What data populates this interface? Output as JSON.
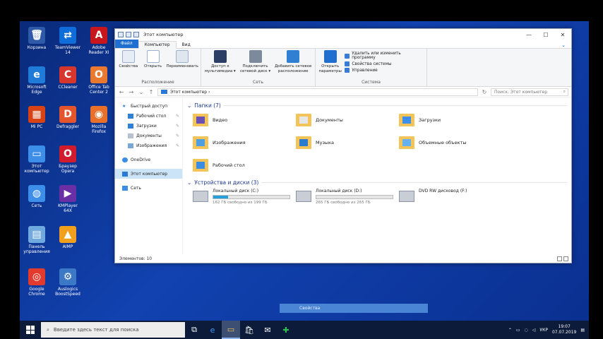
{
  "desktop": {
    "icons": [
      {
        "label": "Корзина",
        "glyph": "🗑",
        "bg": "#2e5aa8"
      },
      {
        "label": "TeamViewer 14",
        "glyph": "⇄",
        "bg": "#0e6dd8"
      },
      {
        "label": "Adobe Reader XI",
        "glyph": "A",
        "bg": "#c8161d"
      },
      {
        "label": "Microsoft Edge",
        "glyph": "e",
        "bg": "#1f7ad8"
      },
      {
        "label": "CCleaner",
        "glyph": "C",
        "bg": "#d6362b"
      },
      {
        "label": "Office Tab Center 2",
        "glyph": "O",
        "bg": "#e9792f"
      },
      {
        "label": "Mi PC",
        "glyph": "▦",
        "bg": "#d84315"
      },
      {
        "label": "Defraggler",
        "glyph": "D",
        "bg": "#e3552d"
      },
      {
        "label": "Mozilla Firefox",
        "glyph": "◉",
        "bg": "#e8702a"
      },
      {
        "label": "Этот компьютер",
        "glyph": "▭",
        "bg": "#3c8ee8"
      },
      {
        "label": "Браузер Opera",
        "glyph": "O",
        "bg": "#d11c2d"
      },
      {
        "label": "Сеть",
        "glyph": "◍",
        "bg": "#3c8ee8"
      },
      {
        "label": "KMPlayer 64X",
        "glyph": "▶",
        "bg": "#6b2fa5"
      },
      {
        "label": "Панель управления",
        "glyph": "▤",
        "bg": "#6fa9e0"
      },
      {
        "label": "AIMP",
        "glyph": "▲",
        "bg": "#f0a01c"
      },
      {
        "label": "Google Chrome",
        "glyph": "◎",
        "bg": "#e23b2e"
      },
      {
        "label": "Auslogics BoostSpeed",
        "glyph": "⚙",
        "bg": "#3b78c5"
      }
    ]
  },
  "window": {
    "title": "Этот компьютер",
    "controls": {
      "minimize": "—",
      "maximize": "☐",
      "close": "✕"
    },
    "tabs": [
      "Файл",
      "Компьютер",
      "Вид"
    ],
    "help": "⌄",
    "ribbon": {
      "location": {
        "name": "Расположение",
        "buttons": [
          "Свойства",
          "Открыть",
          "Переименовать"
        ]
      },
      "network": {
        "name": "Сеть",
        "buttons": [
          "Доступ к мультимедиа ▾",
          "Подключить сетевой диск ▾",
          "Добавить сетевое расположение"
        ]
      },
      "system": {
        "name": "Система",
        "open_params": "Открыть параметры",
        "items": [
          "Удалить или изменить программу",
          "Свойства системы",
          "Управление"
        ]
      }
    },
    "address": {
      "path": "Этот компьютер ›",
      "search_placeholder": "Поиск: Этот компьютер",
      "back": "←",
      "forward": "→",
      "up": "↑",
      "recent": "⌄",
      "refresh": "↻"
    },
    "nav": {
      "quick_access": "Быстрый доступ",
      "items": [
        "Рабочий стол",
        "Загрузки",
        "Документы",
        "Изображения"
      ],
      "onedrive": "OneDrive",
      "this_pc": "Этот компьютер",
      "network": "Сеть"
    },
    "folders_header": "Папки (7)",
    "folders": [
      {
        "name": "Видео",
        "inner": "#6a4fb4"
      },
      {
        "name": "Документы",
        "inner": "#e6e6e6"
      },
      {
        "name": "Загрузки",
        "inner": "#3c8ee8"
      },
      {
        "name": "Изображения",
        "inner": "#4d9fe0"
      },
      {
        "name": "Музыка",
        "inner": "#2a7bd0"
      },
      {
        "name": "Объемные объекты",
        "inner": "#67b1ee"
      },
      {
        "name": "Рабочий стол",
        "inner": "#3a8de0"
      }
    ],
    "drives_header": "Устройства и диски (3)",
    "drives": [
      {
        "name": "Локальный диск (C:)",
        "free": "162 ГБ свободно из 199 ГБ",
        "used": 0.19
      },
      {
        "name": "Локальный диск (D:)",
        "free": "265 ГБ свободно из 265 ГБ",
        "used": 0.0
      },
      {
        "name": "DVD RW дисковод (F:)",
        "free": "",
        "used": null
      }
    ],
    "status": "Элементов: 10"
  },
  "tooltip": "Свойства",
  "taskbar": {
    "search_placeholder": "Введите здесь текст для поиска",
    "apps": [
      "⧉",
      "e",
      "▭",
      "🛍",
      "✉",
      "✚"
    ],
    "tray": {
      "chevron": "⌃",
      "lang": "УКР",
      "time": "19:07",
      "date": "07.07.2019"
    }
  }
}
